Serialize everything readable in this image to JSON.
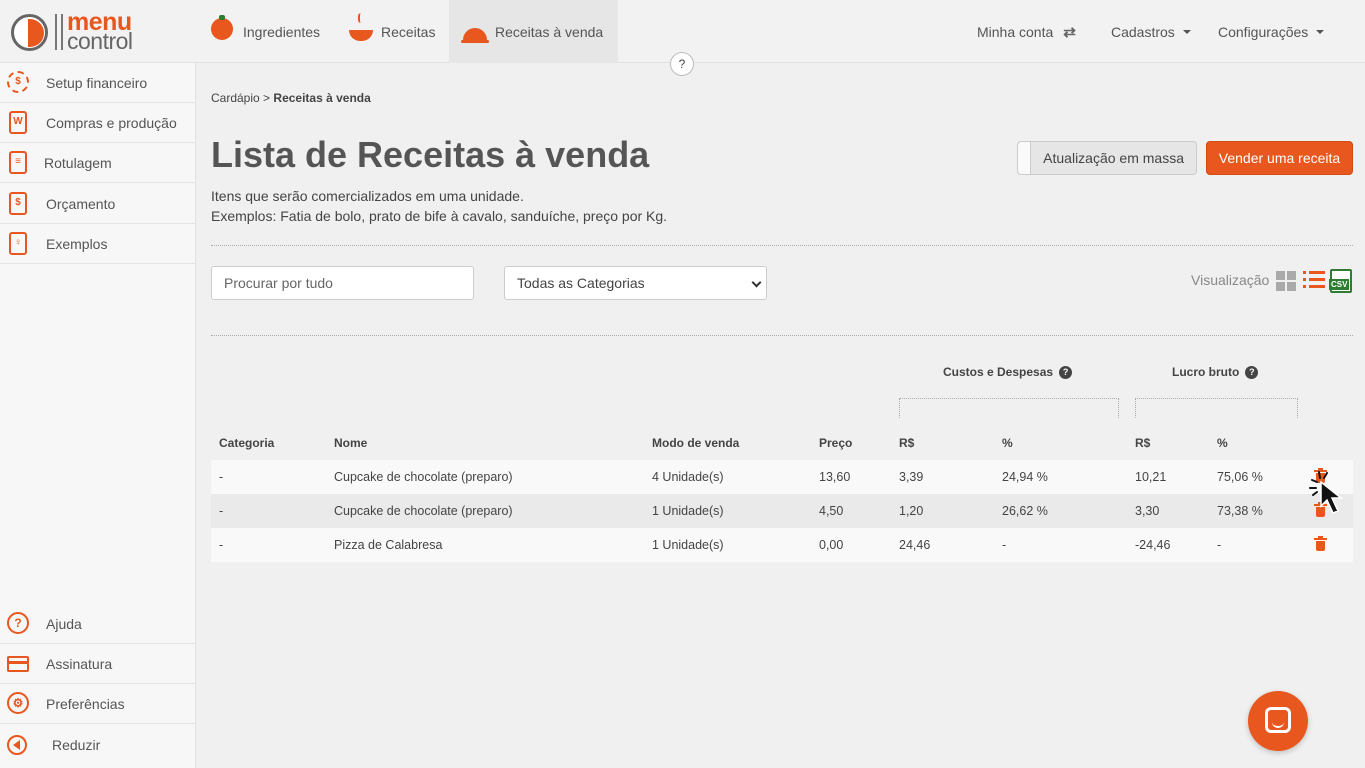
{
  "app": {
    "logo_line1": "menu",
    "logo_line2": "control"
  },
  "topnav": {
    "items": [
      {
        "label": "Ingredientes",
        "icon": "tomato-icon"
      },
      {
        "label": "Receitas",
        "icon": "bowl-icon"
      },
      {
        "label": "Receitas à venda",
        "icon": "cloche-icon",
        "active": true
      }
    ],
    "account": "Minha conta",
    "registers": "Cadastros",
    "settings": "Configurações",
    "help": "?"
  },
  "sidebar": {
    "items": [
      {
        "label": "Setup financeiro",
        "icon": "gear-dollar-icon",
        "glyph": "$"
      },
      {
        "label": "Compras e produção",
        "icon": "shopping-list-icon",
        "glyph": "W"
      },
      {
        "label": "Rotulagem",
        "icon": "label-icon",
        "glyph": "≡"
      },
      {
        "label": "Orçamento",
        "icon": "budget-icon",
        "glyph": "$"
      },
      {
        "label": "Exemplos",
        "icon": "examples-icon",
        "glyph": "♀"
      }
    ],
    "bottom": [
      {
        "label": "Ajuda",
        "icon": "help-icon",
        "glyph": "?"
      },
      {
        "label": "Assinatura",
        "icon": "credit-card-icon"
      },
      {
        "label": "Preferências",
        "icon": "gear-icon",
        "glyph": "⚙"
      },
      {
        "label": "Reduzir",
        "icon": "collapse-icon"
      }
    ]
  },
  "breadcrumb": {
    "parent": "Cardápio",
    "sep": ">",
    "current": "Receitas à venda"
  },
  "page": {
    "title": "Lista de Receitas à venda",
    "desc1": "Itens que serão comercializados em uma unidade.",
    "desc2": "Exemplos: Fatia de bolo, prato de bife à cavalo, sanduíche, preço por Kg.",
    "mass_update": "Atualização em massa",
    "sell_button": "Vender uma receita"
  },
  "filters": {
    "search_placeholder": "Procurar por tudo",
    "category_selected": "Todas as Categorias",
    "view_label": "Visualização",
    "csv": "CSV"
  },
  "table": {
    "group_costs": "Custos e Despesas",
    "group_profit": "Lucro bruto",
    "headers": [
      "Categoria",
      "Nome",
      "Modo de venda",
      "Preço",
      "R$",
      "%",
      "R$",
      "%"
    ],
    "rows": [
      {
        "categoria": "-",
        "nome": "Cupcake de chocolate (preparo)",
        "modo": "4 Unidade(s)",
        "preco": "13,60",
        "custo_rs": "3,39",
        "custo_pct": "24,94 %",
        "lucro_rs": "10,21",
        "lucro_pct": "75,06 %"
      },
      {
        "categoria": "-",
        "nome": "Cupcake de chocolate (preparo)",
        "modo": "1 Unidade(s)",
        "preco": "4,50",
        "custo_rs": "1,20",
        "custo_pct": "26,62 %",
        "lucro_rs": "3,30",
        "lucro_pct": "73,38 %"
      },
      {
        "categoria": "-",
        "nome": "Pizza de Calabresa",
        "modo": "1 Unidade(s)",
        "preco": "0,00",
        "custo_rs": "24,46",
        "custo_pct": "-",
        "lucro_rs": "-24,46",
        "lucro_pct": "-"
      }
    ]
  },
  "colors": {
    "accent": "#e8571e",
    "csv": "#2e7d32"
  }
}
